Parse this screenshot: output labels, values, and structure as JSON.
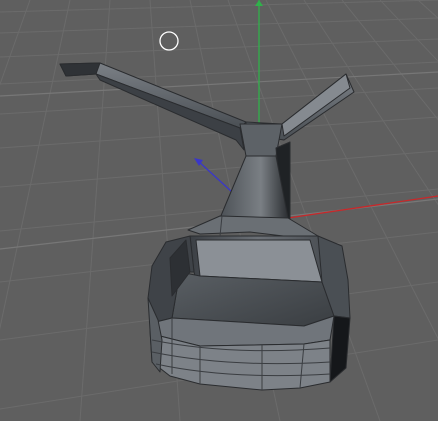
{
  "viewport": {
    "mode": "perspective",
    "background": "#5f5f5f",
    "grid": true,
    "grid_color": "#6b6b6b",
    "grid_major_color": "#727272"
  },
  "axes": {
    "x_color": "#c8282a",
    "y_color": "#2fb24a",
    "z_color": "#3a37c8"
  },
  "cursor": {
    "shape": "circle",
    "color": "#ffffff"
  },
  "object": {
    "kind": "polygon-mesh",
    "shading": "flat",
    "base_color": "#4d5257",
    "edge_color": "#2a2c2f"
  }
}
